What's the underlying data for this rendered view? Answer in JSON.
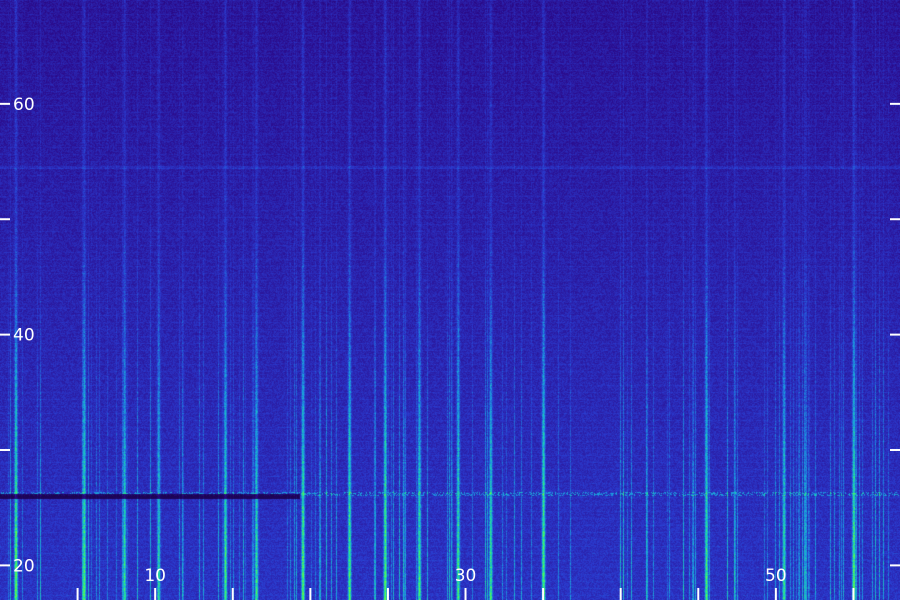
{
  "chart_data": {
    "type": "heatmap",
    "title": "",
    "xlabel": "",
    "ylabel": "",
    "xlim": [
      0,
      58
    ],
    "ylim": [
      17,
      69
    ],
    "x_tick_labels": [
      {
        "value": 10,
        "label": "10"
      },
      {
        "value": 30,
        "label": "30"
      },
      {
        "value": 50,
        "label": "50"
      }
    ],
    "y_tick_labels": [
      {
        "value": 20,
        "label": "20"
      },
      {
        "value": 40,
        "label": "40"
      },
      {
        "value": 60,
        "label": "60"
      }
    ],
    "x_minor_ticks": [
      5,
      10,
      15,
      20,
      25,
      30,
      35,
      40,
      45,
      50,
      55
    ],
    "y_minor_ticks": [
      20,
      30,
      40,
      50,
      60
    ],
    "colormap": [
      "#12002e",
      "#2a0a8a",
      "#2a3cd0",
      "#1aa0e0",
      "#20e0a0",
      "#60ff40"
    ],
    "bright_tracks_x": [
      1,
      5.4,
      8,
      10.2,
      14.5,
      16.5,
      19.5,
      22.5,
      24.8,
      27,
      29.5,
      31.6,
      35,
      45.5,
      50.5,
      55
    ],
    "dark_band_y": 26
  }
}
